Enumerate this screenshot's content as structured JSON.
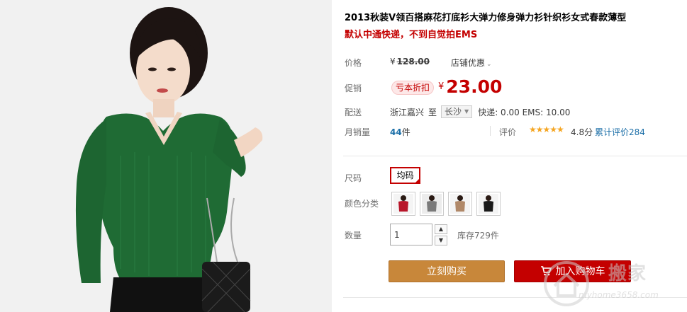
{
  "product": {
    "title": "2013秋装V领百搭麻花打底衫大弹力修身弹力衫针织衫女式春款薄型",
    "subtitle": "默认中通快递，不到自觉拍EMS"
  },
  "price": {
    "label": "价格",
    "currency": "¥",
    "original": "128.00",
    "shop_discount": "店铺优惠",
    "chevron": "⌄"
  },
  "promo": {
    "label": "促销",
    "tag": "亏本折扣",
    "currency": "¥",
    "price": "23.00"
  },
  "shipping": {
    "label": "配送",
    "origin": "浙江嘉兴",
    "to": "至",
    "destination": "长沙",
    "fees": "快递: 0.00 EMS: 10.00"
  },
  "sales": {
    "label": "月销量",
    "count": "44",
    "unit": "件",
    "rating_label": "评价",
    "stars": "★★★★★",
    "score": "4.8分",
    "reviews": "累计评价284"
  },
  "size": {
    "label": "尺码",
    "options": [
      "均码"
    ],
    "selected": "均码"
  },
  "color": {
    "label": "颜色分类",
    "swatches": [
      {
        "name": "red",
        "hex": "#b8162a"
      },
      {
        "name": "grey",
        "hex": "#7a7a7a"
      },
      {
        "name": "camel",
        "hex": "#b08868"
      },
      {
        "name": "black",
        "hex": "#1a1a1a"
      }
    ]
  },
  "quantity": {
    "label": "数量",
    "value": "1",
    "up": "▲",
    "down": "▼",
    "stock": "库存729件"
  },
  "actions": {
    "buy_now": "立刻购买",
    "add_to_cart": "加入购物车"
  },
  "watermark": {
    "brand": "搬家",
    "url": "myhome3658.com"
  },
  "colors": {
    "accent_red": "#c40000",
    "buy_orange": "#c8873a",
    "sweater_green": "#1f6b34",
    "link_blue": "#1c6fa8"
  }
}
